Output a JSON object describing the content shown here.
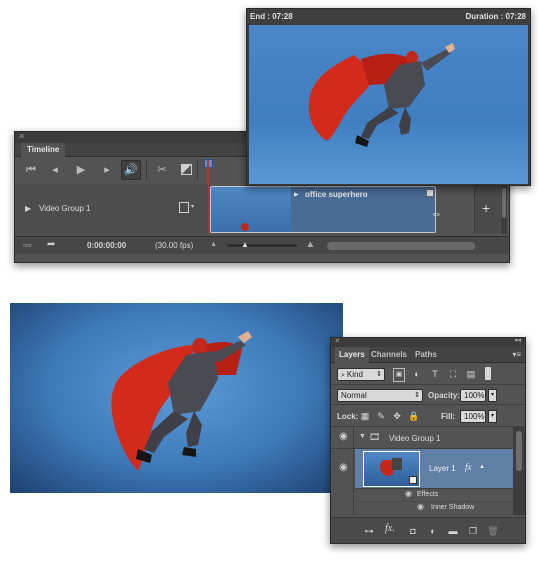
{
  "preview": {
    "end_label": "End : 07:28",
    "duration_label": "Duration : 07:28"
  },
  "timeline": {
    "close_glyph": "×",
    "tab_label": "Timeline",
    "track_label": "Video Group 1",
    "clip_label": "office superhero",
    "current_time": "0:00:00:00",
    "fps": "(30.00 fps)",
    "add_glyph": "+"
  },
  "layers": {
    "close_glyph": "×",
    "tabs": [
      "Layers",
      "Channels",
      "Paths"
    ],
    "filter_kind": "Kind",
    "blend_mode": "Normal",
    "opacity_label": "Opacity:",
    "opacity_value": "100%",
    "lock_label": "Lock:",
    "fill_label": "Fill:",
    "fill_value": "100%",
    "group_name": "Video Group 1",
    "layer_name": "Layer 1",
    "fx_glyph": "fx",
    "effects_label": "Effects",
    "inner_shadow_label": "Inner Shadow"
  },
  "colors": {
    "panel_bg": "#535353",
    "sky_blue": "#4a86c8",
    "cape_red": "#d42a1c",
    "playhead_red": "#b33333"
  }
}
